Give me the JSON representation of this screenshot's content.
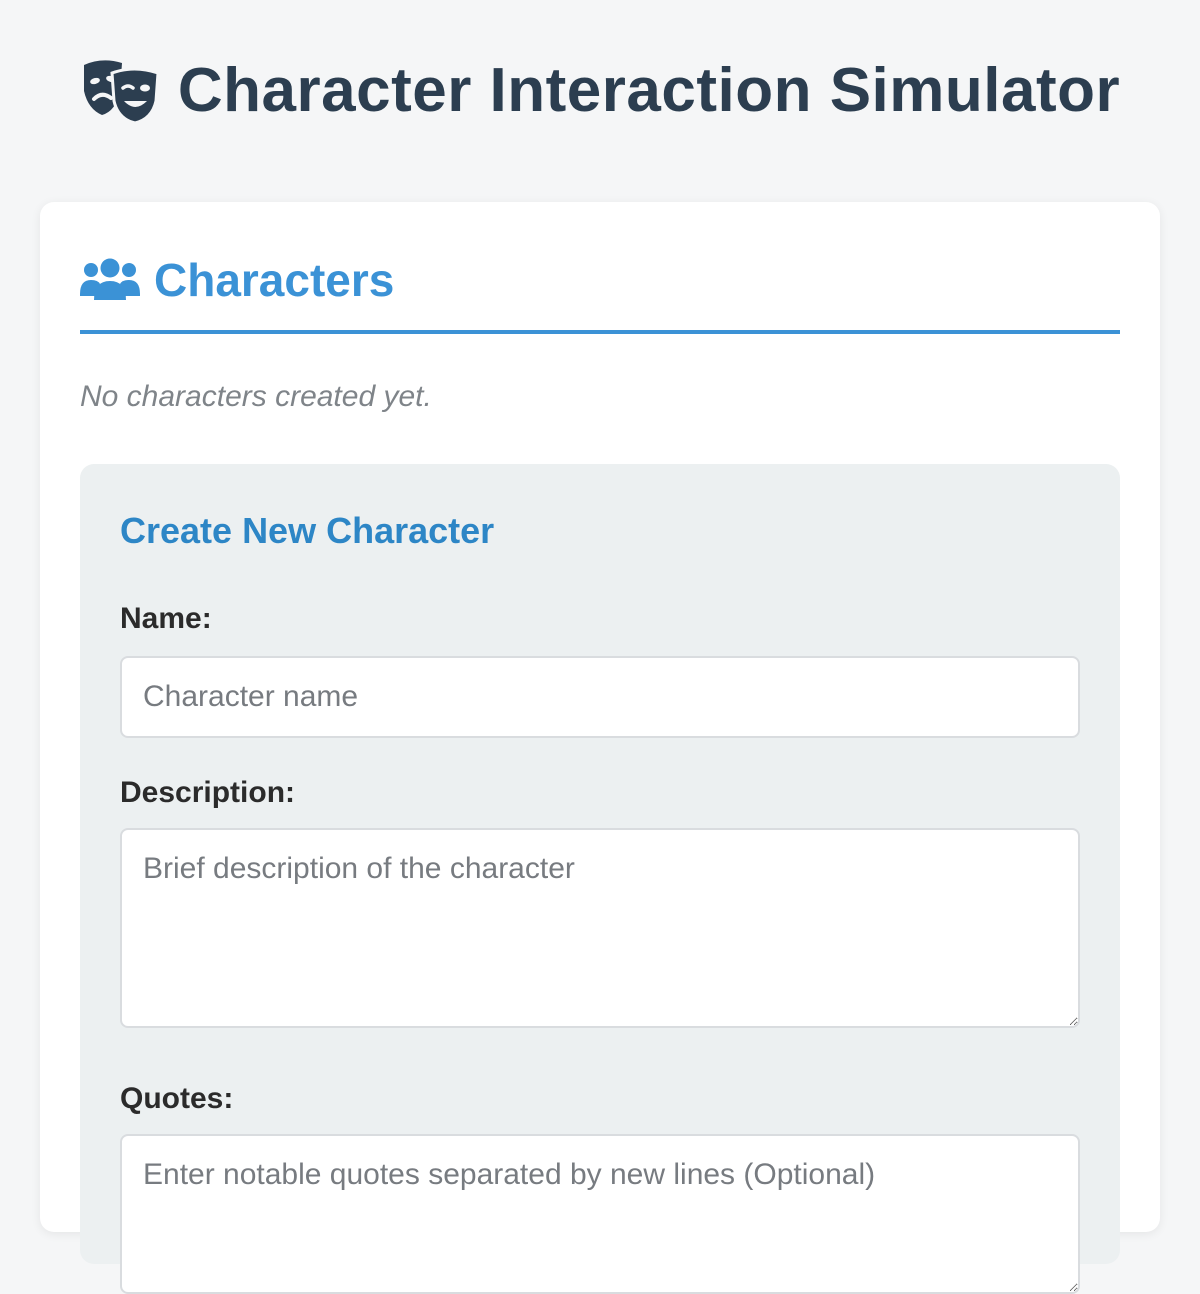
{
  "header": {
    "title": "Character Interaction Simulator",
    "icon": "theater-masks-icon"
  },
  "characters_panel": {
    "title": "Characters",
    "icon": "users-icon",
    "empty_message": "No characters created yet."
  },
  "create_form": {
    "title": "Create New Character",
    "name": {
      "label": "Name:",
      "placeholder": "Character name",
      "value": ""
    },
    "description": {
      "label": "Description:",
      "placeholder": "Brief description of the character",
      "value": ""
    },
    "quotes": {
      "label": "Quotes:",
      "placeholder": "Enter notable quotes separated by new lines (Optional)",
      "value": ""
    }
  },
  "colors": {
    "title_text": "#2c3e50",
    "accent_blue": "#3b92d6",
    "form_title_blue": "#2d86c6",
    "page_bg": "#f5f6f7",
    "form_bg": "#ecf0f1"
  }
}
